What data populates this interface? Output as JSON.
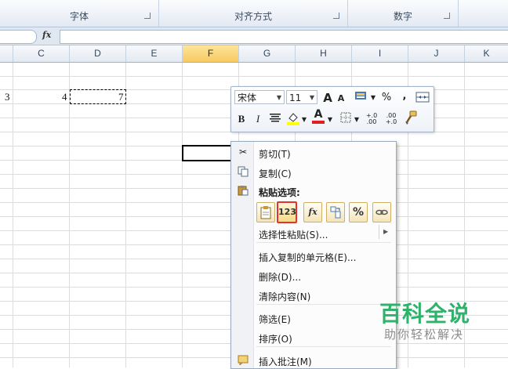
{
  "ribbon": {
    "groups": [
      "字体",
      "对齐方式",
      "数字"
    ]
  },
  "formula_bar": {
    "fx_label": "fx",
    "value": ""
  },
  "columns": [
    "C",
    "D",
    "E",
    "F",
    "G",
    "H",
    "I",
    "J",
    "K"
  ],
  "selected_column": "F",
  "cells": {
    "b_value": "3",
    "c_value": "4",
    "d_value": "7"
  },
  "mini_toolbar": {
    "font_name": "宋体",
    "font_size": "11",
    "grow_font": "A",
    "shrink_font": "A",
    "percent": "%",
    "comma": ",",
    "bold": "B",
    "italic": "I",
    "font_color": "A",
    "inc_decimal": "+.0 .00",
    "dec_decimal": ".00 +.0"
  },
  "context_menu": {
    "cut": "剪切(T)",
    "copy": "复制(C)",
    "paste_options_header": "粘贴选项:",
    "paste_buttons": [
      "",
      "123",
      "fx",
      "",
      "%",
      ""
    ],
    "paste_special": "选择性粘贴(S)...",
    "insert_copied_cells": "插入复制的单元格(E)...",
    "delete": "删除(D)...",
    "clear_contents": "清除内容(N)",
    "filter": "筛选(E)",
    "sort": "排序(O)",
    "insert_comment": "插入批注(M)"
  },
  "watermark": {
    "title": "百科全说",
    "subtitle": "助你轻松解决"
  },
  "colors": {
    "selected_header": "#f8c961",
    "highlight_border": "#e3332f",
    "watermark_green": "#2fb26a"
  }
}
